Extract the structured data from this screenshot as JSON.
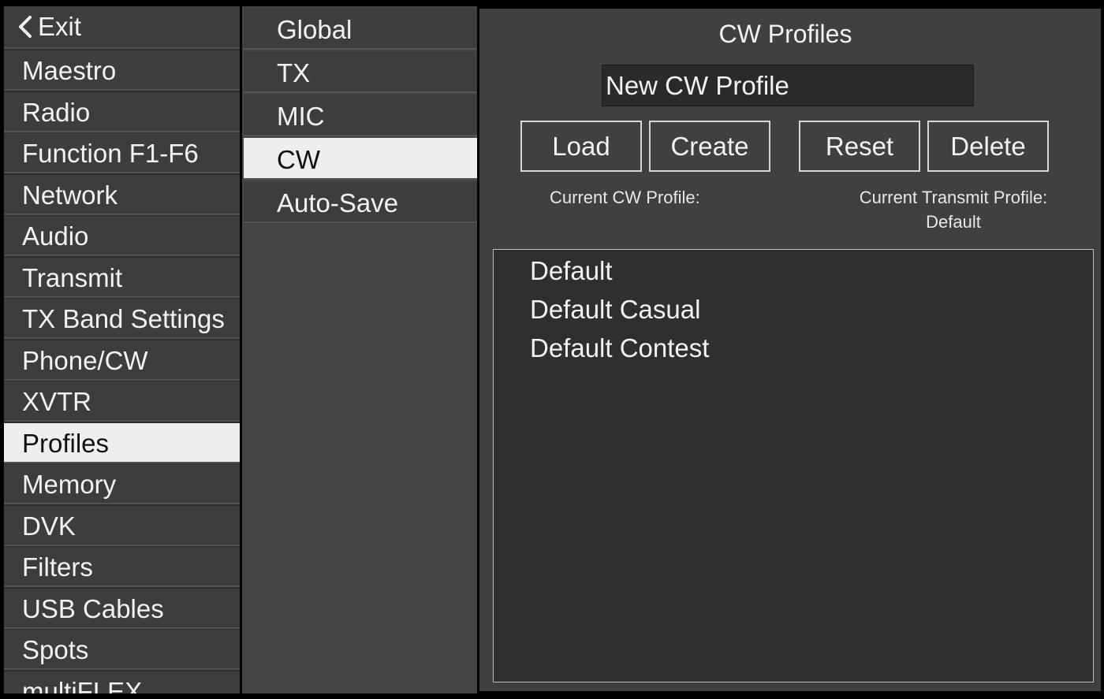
{
  "sidebar": {
    "exit_label": "Exit",
    "items": [
      {
        "label": "Maestro"
      },
      {
        "label": "Radio"
      },
      {
        "label": "Function F1-F6"
      },
      {
        "label": "Network"
      },
      {
        "label": "Audio"
      },
      {
        "label": "Transmit"
      },
      {
        "label": "TX Band Settings"
      },
      {
        "label": "Phone/CW"
      },
      {
        "label": "XVTR"
      },
      {
        "label": "Profiles",
        "active": true
      },
      {
        "label": "Memory"
      },
      {
        "label": "DVK"
      },
      {
        "label": "Filters"
      },
      {
        "label": "USB Cables"
      },
      {
        "label": "Spots"
      },
      {
        "label": "multiFLEX"
      }
    ]
  },
  "submenu": {
    "items": [
      {
        "label": "Global"
      },
      {
        "label": "TX"
      },
      {
        "label": "MIC"
      },
      {
        "label": "CW",
        "active": true
      },
      {
        "label": "Auto-Save"
      }
    ]
  },
  "main": {
    "title": "CW Profiles",
    "profile_name_value": "New CW Profile",
    "buttons": {
      "load": "Load",
      "create": "Create",
      "reset": "Reset",
      "delete": "Delete"
    },
    "current_cw_profile_label": "Current CW Profile:",
    "current_cw_profile_value": "",
    "current_transmit_profile_label": "Current Transmit Profile:",
    "current_transmit_profile_value": "Default",
    "profiles": [
      "Default",
      "Default Casual",
      "Default Contest"
    ]
  },
  "colors": {
    "background": "#000000",
    "panel": "#404040",
    "item": "#3d3d3d",
    "active_item": "#eeeeee",
    "text": "#f2f2f2"
  },
  "icons": {
    "exit": "chevron-left-icon"
  }
}
